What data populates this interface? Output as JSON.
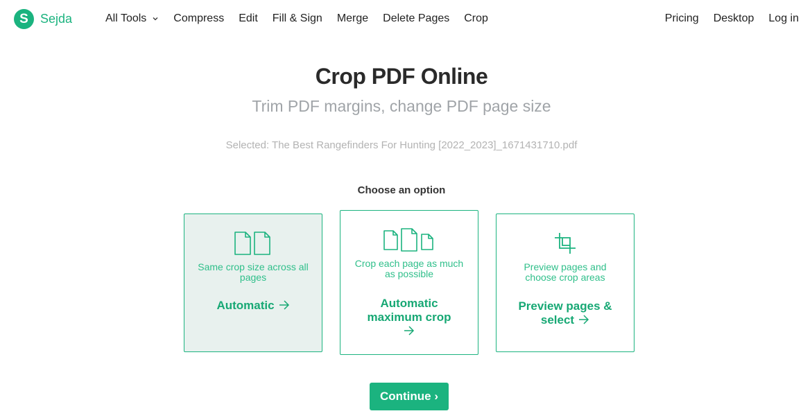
{
  "brand": {
    "name": "Sejda",
    "logo_letter": "S",
    "color": "#1bb37f"
  },
  "nav": {
    "all_tools": "All Tools",
    "items": [
      "Compress",
      "Edit",
      "Fill & Sign",
      "Merge",
      "Delete Pages",
      "Crop"
    ],
    "right": [
      "Pricing",
      "Desktop",
      "Log in"
    ]
  },
  "main": {
    "title": "Crop PDF Online",
    "subtitle": "Trim PDF margins, change PDF page size",
    "selected_file": "Selected: The Best Rangefinders For Hunting [2022_2023]_1671431710.pdf",
    "choose_label": "Choose an option"
  },
  "options": [
    {
      "icon": "two-pages-icon",
      "desc": "Same crop size across all pages",
      "action": "Automatic",
      "active": true
    },
    {
      "icon": "three-pages-icon",
      "desc": "Crop each page as much as possible",
      "action": "Automatic maximum crop",
      "active": false
    },
    {
      "icon": "crop-icon",
      "desc": "Preview pages and choose crop areas",
      "action": "Preview pages & select",
      "active": false
    }
  ],
  "continue_label": "Continue"
}
